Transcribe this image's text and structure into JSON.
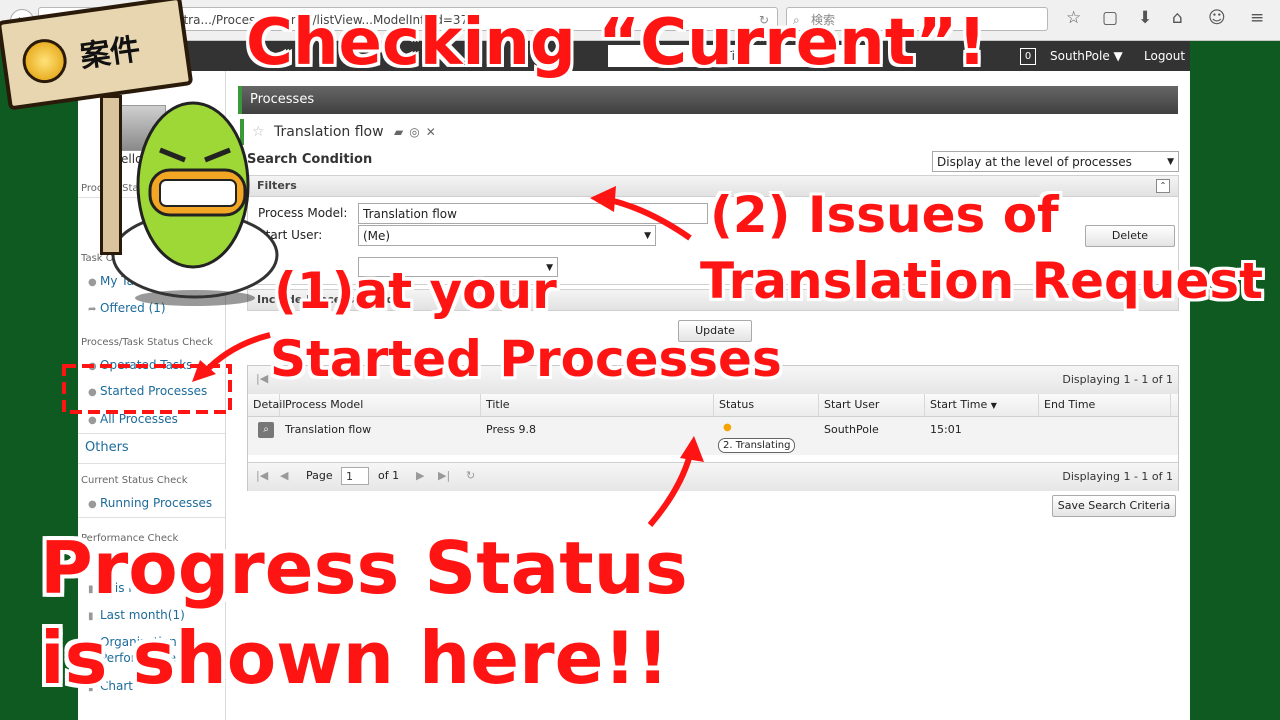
{
  "browser": {
    "url": "https://s...en.questetra.../ProcessInstance/listView...ModelInfoId=377",
    "search_placeholder": "検索"
  },
  "header": {
    "search_placeholder": "ID or Title",
    "badge": "0",
    "user": "SouthPole ▼",
    "logout": "Logout"
  },
  "sidebar": {
    "hello": "Hello,",
    "process_status_title": "Process Status",
    "task_title": "Task Operation",
    "my_tasks": "My Tasks",
    "offered": "Offered (1)",
    "status_check_title": "Process/Task Status Check",
    "operated_tasks": "Operated Tasks",
    "started_processes": "Started Processes",
    "all_processes": "All Processes",
    "others": "Others",
    "current_status_title": "Current Status Check",
    "running_processes": "Running Processes",
    "performance_title": "Performance Check",
    "this_month": "This month",
    "last_month": "Last month(1)",
    "organizational": "Organizational",
    "performance": "Performance",
    "chart": "Chart"
  },
  "main": {
    "processes_title": "Processes",
    "flow_title": "Translation flow",
    "search_condition": "Search Condition",
    "display_level": "Display at the level of processes",
    "filters": "Filters",
    "process_model_label": "Process Model:",
    "process_model_value": "Translation flow",
    "start_user_label": "Start User:",
    "start_user_value": "(Me)",
    "delete_button": "Delete",
    "include_label": "Include Process Search",
    "update_button": "Update",
    "displaying": "Displaying 1 - 1 of 1",
    "columns": [
      "Detail",
      "Process Model",
      "Title",
      "Status",
      "Start User",
      "Start Time",
      "End Time"
    ],
    "row": {
      "process_model": "Translation flow",
      "title": "Press 9.8",
      "status": "2. Translating",
      "start_user": "SouthPole",
      "start_time": "15:01",
      "end_time": ""
    },
    "page_label": "Page",
    "page_value": "1",
    "of_pages": "of 1",
    "save_criteria": "Save Search Criteria"
  },
  "overlay": {
    "sign": "案件",
    "headline": "Checking “Current”!",
    "issues_line1": "(2) Issues of",
    "issues_line2": "Translation Request",
    "started_line1": "(1)at your",
    "started_line2": "Started Processes",
    "progress_line1": "Progress Status",
    "progress_line2": "is shown here!!"
  },
  "colors": {
    "background_green": "#0f5a21",
    "overlay_red": "#ff1414",
    "accent_green": "#3a9a3a",
    "status_dot": "#f5a300"
  }
}
